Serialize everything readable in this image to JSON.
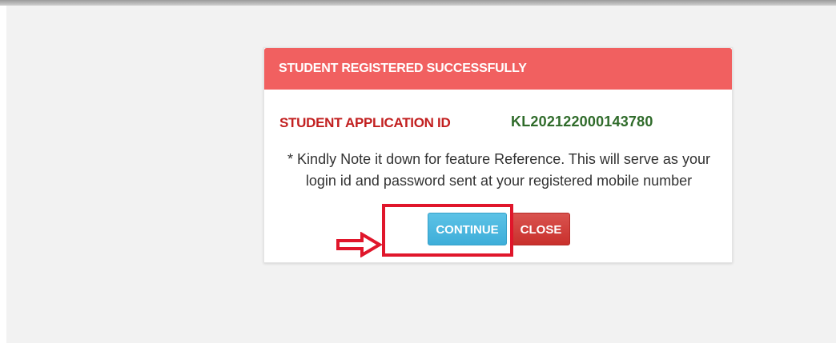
{
  "modal": {
    "title": "STUDENT REGISTERED SUCCESSFULLY",
    "id_label": "STUDENT APPLICATION ID",
    "id_value": "KL202122000143780",
    "note": "* Kindly Note it down for feature Reference. This will serve as your login id and password sent at your registered mobile number",
    "continue_label": "CONTINUE",
    "close_label": "CLOSE"
  },
  "colors": {
    "header": "#f16060",
    "id_label": "#c22020",
    "id_value": "#2f6b2a",
    "continue_button": "#3eaed9",
    "close_button": "#c9302c",
    "annotation": "#e0162b"
  },
  "annotations": {
    "arrow_icon": "right-arrow-icon",
    "highlight": "highlight-box"
  }
}
